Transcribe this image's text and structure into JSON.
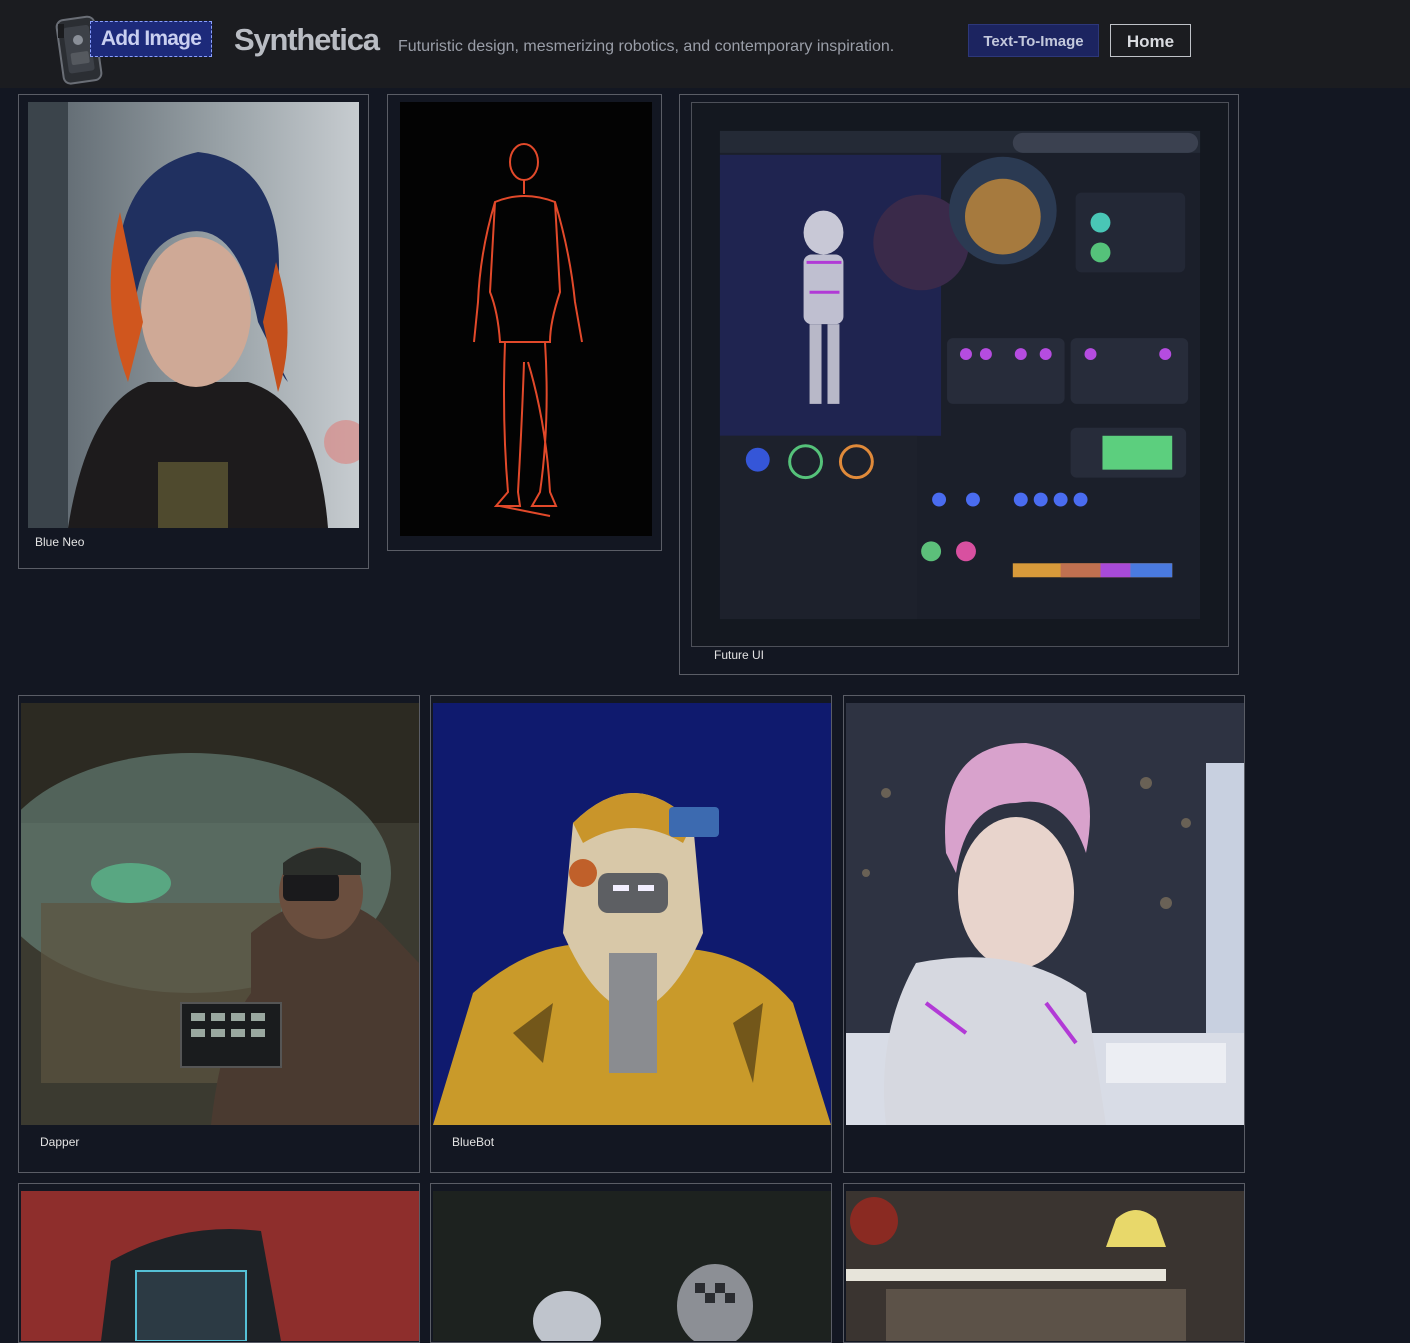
{
  "header": {
    "logo_icon": "robot-phone-icon",
    "add_image_label": "Add Image",
    "brand": "Synthetica",
    "tagline": "Futuristic design, mesmerizing robotics, and contemporary inspiration.",
    "nav": {
      "text_to_image": "Text-To-Image",
      "home": "Home"
    }
  },
  "gallery": {
    "cards": [
      {
        "caption": "Blue Neo",
        "image": "portrait-woman-blue-orange-hair"
      },
      {
        "caption": "",
        "image": "red-wireframe-human-figure"
      },
      {
        "caption": "Future UI",
        "image": "futuristic-robot-dashboard-ui"
      },
      {
        "caption": "Dapper",
        "image": "man-vr-headset-city-dome"
      },
      {
        "caption": "BlueBot",
        "image": "robot-head-yellow-jacket"
      },
      {
        "caption": "",
        "image": "android-pink-hair-keyboard"
      },
      {
        "caption": "",
        "image": "red-background-device"
      },
      {
        "caption": "",
        "image": "two-robot-heads-dark"
      },
      {
        "caption": "",
        "image": "workshop-yellow-lamp"
      }
    ]
  },
  "colors": {
    "page_bg": "#131722",
    "header_bg": "#1b1c20",
    "accent_button": "#1c2460",
    "card_border": "#5a5d66"
  }
}
